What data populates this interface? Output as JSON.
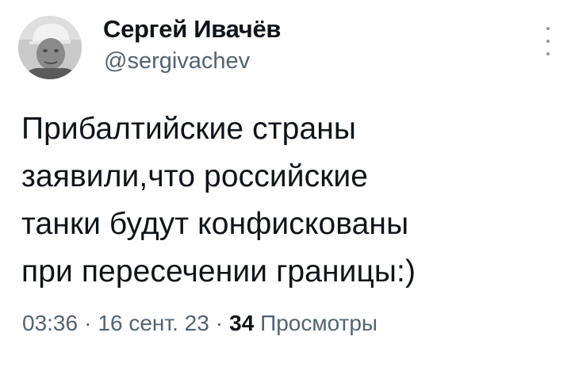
{
  "author": {
    "display_name": "Сергей Ивачёв",
    "handle": "@sergivachev"
  },
  "tweet": {
    "lines": [
      "Прибалтийские страны",
      "заявили,что российские",
      "танки будут конфискованы",
      "при пересечении границы:)"
    ]
  },
  "meta": {
    "time": "03:36",
    "separator": "·",
    "date": "16 сент. 23",
    "views_count": "34",
    "views_label": "Просмотры"
  },
  "icons": {
    "more": "more-vertical-icon",
    "avatar": "profile-photo"
  },
  "colors": {
    "text": "#0f1419",
    "secondary": "#536471",
    "background": "#ffffff"
  }
}
